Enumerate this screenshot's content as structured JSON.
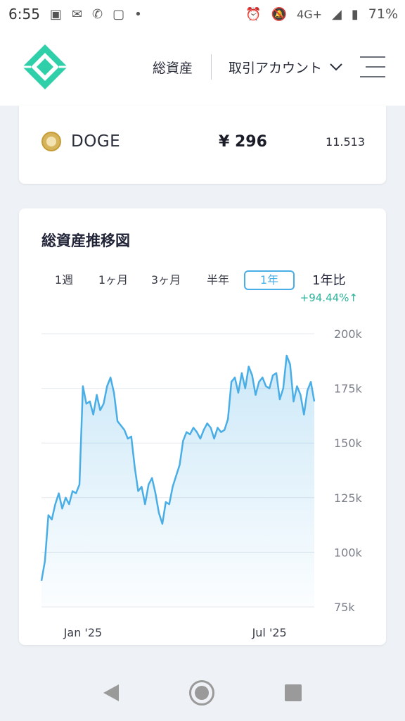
{
  "status_bar": {
    "time": "6:55",
    "network": "4G+",
    "battery": "71%"
  },
  "header": {
    "nav_total": "総資産",
    "nav_account": "取引アカウント"
  },
  "holding": {
    "coin": "DOGE",
    "value": "¥ 296",
    "amount": "11.513"
  },
  "chart_section": {
    "title": "総資産推移図",
    "periods": [
      "1週",
      "1ヶ月",
      "3ヶ月",
      "半年",
      "1年"
    ],
    "active_period": "1年",
    "compare_label": "1年比",
    "compare_value": "+94.44%↑"
  },
  "chart_data": {
    "type": "area",
    "ylim": [
      75000,
      200000
    ],
    "y_ticks": [
      200000,
      175000,
      150000,
      125000,
      100000,
      75000
    ],
    "y_tick_labels": [
      "200k",
      "175k",
      "150k",
      "125k",
      "100k",
      "75k"
    ],
    "x_tick_labels": [
      {
        "label": "Jan '25",
        "index": 12
      },
      {
        "label": "Jul '25",
        "index": 66
      }
    ],
    "color": "#4aaee6",
    "grid": true,
    "series": [
      {
        "values": [
          87000,
          96000,
          117000,
          115000,
          122000,
          127000,
          120000,
          125000,
          122000,
          128000,
          127000,
          131000,
          176000,
          168000,
          169000,
          163000,
          172000,
          165000,
          168000,
          176000,
          180000,
          173000,
          160000,
          158000,
          156000,
          152000,
          153000,
          139000,
          128000,
          130000,
          122000,
          131000,
          134000,
          127000,
          118000,
          113000,
          123000,
          122000,
          130000,
          135000,
          140000,
          151000,
          155000,
          154000,
          157000,
          155000,
          152000,
          156000,
          159000,
          157000,
          152000,
          157000,
          155000,
          156000,
          161000,
          178000,
          180000,
          173000,
          182000,
          175000,
          185000,
          181000,
          172000,
          178000,
          180000,
          176000,
          175000,
          181000,
          182000,
          170000,
          175000,
          190000,
          186000,
          169000,
          176000,
          172000,
          163000,
          174000,
          178000,
          169000
        ]
      }
    ]
  }
}
